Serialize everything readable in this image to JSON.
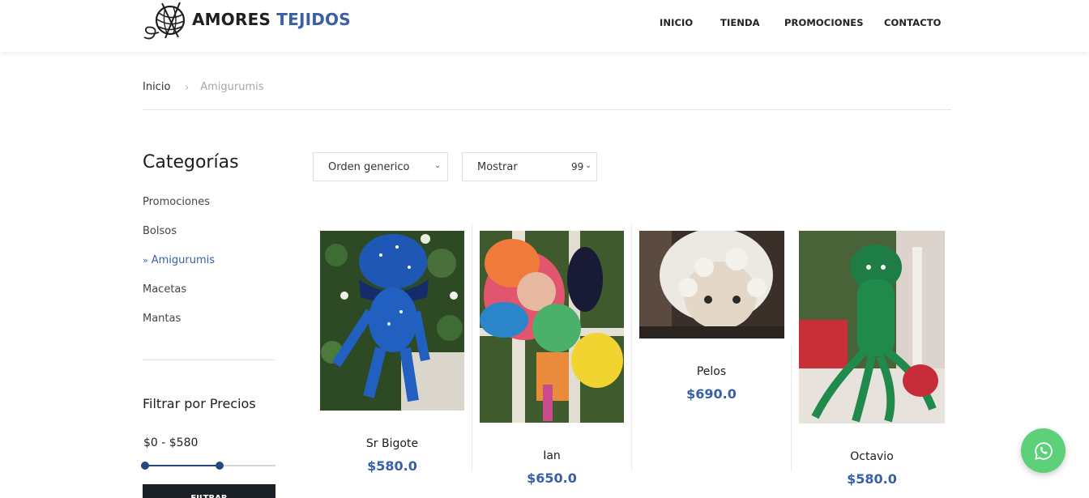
{
  "brand": {
    "name_part1": "AMORES",
    "name_part2": "TEJIDOS",
    "dark_color": "#1f1f1f",
    "accent_color": "#3a5fa8"
  },
  "nav": {
    "items": [
      "INICIO",
      "TIENDA",
      "PROMOCIONES",
      "CONTACTO"
    ]
  },
  "breadcrumb": {
    "home": "Inicio",
    "separator": "›",
    "current": "Amigurumis"
  },
  "sidebar": {
    "title": "Categorías",
    "categories": [
      {
        "label": "Promociones",
        "active": false
      },
      {
        "label": "Bolsos",
        "active": false
      },
      {
        "label": "Amigurumis",
        "active": true
      },
      {
        "label": "Macetas",
        "active": false
      },
      {
        "label": "Mantas",
        "active": false
      }
    ],
    "active_marker": "»",
    "price_filter": {
      "title": "Filtrar por Precios",
      "range_label": "$0 - $580",
      "min_value": 0,
      "max_value": 580,
      "button_label": "FILTRAR"
    }
  },
  "toolbar": {
    "sort": {
      "selected": "Orden generico",
      "icon": "chevron-down-icon"
    },
    "show": {
      "label": "Mostrar",
      "value": "99",
      "icon": "chevron-down-icon"
    }
  },
  "products": [
    {
      "name": "Sr Bigote",
      "price": "$580.0"
    },
    {
      "name": "Ian",
      "price": "$650.0"
    },
    {
      "name": "Pelos",
      "price": "$690.0"
    },
    {
      "name": "Octavio",
      "price": "$580.0"
    }
  ],
  "whatsapp": {
    "icon": "whatsapp-icon",
    "color": "#5dd07a"
  }
}
